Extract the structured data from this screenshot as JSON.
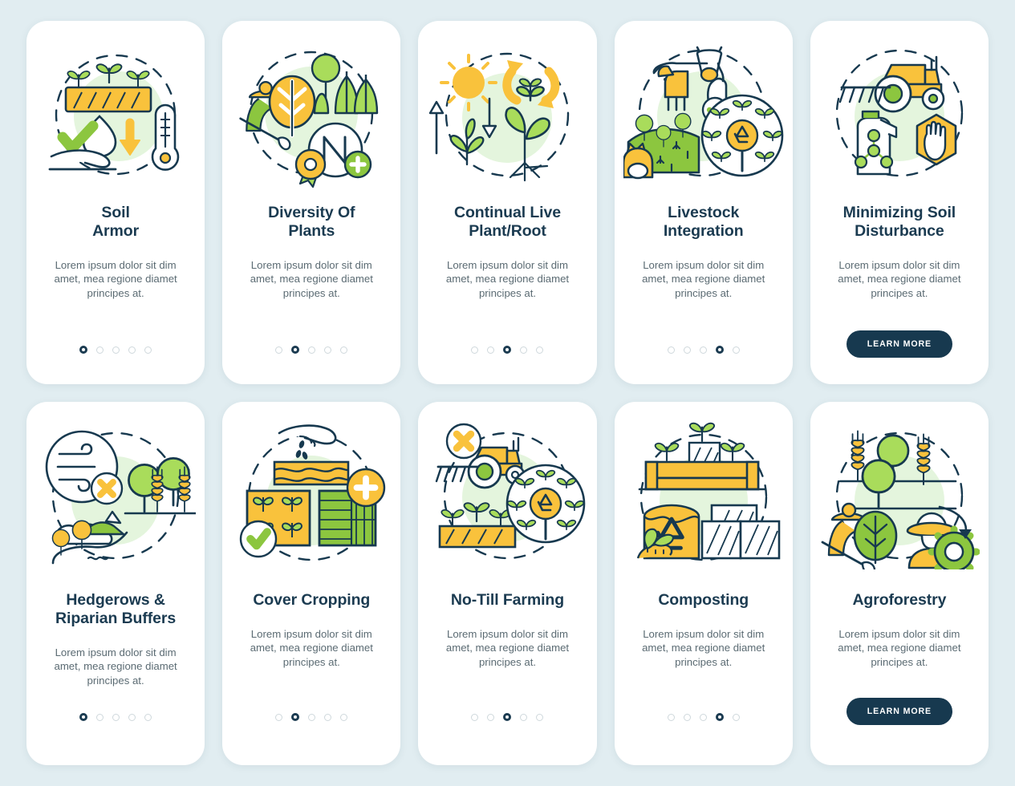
{
  "palette": {
    "background": "#e1edf1",
    "card": "#ffffff",
    "title": "#1b3b51",
    "body_text": "#5b6b73",
    "accent_green": "#8cc63f",
    "accent_green_light": "#a6d94f",
    "accent_yellow": "#f9c23c",
    "accent_dark": "#17394f",
    "halo_green": "#e4f5dd",
    "dot_inactive": "#cfd8dc",
    "dot_active": "#1b3b51",
    "cta_background": "#17394f",
    "cta_text": "#ffffff"
  },
  "common": {
    "description": "Lorem ipsum dolor sit dim amet, mea regione diamet principes at.",
    "cta_label": "LEARN MORE",
    "dot_count": 5
  },
  "cards": [
    {
      "id": "soil-armor",
      "title_lines": [
        "Soil",
        "Armor"
      ],
      "icon": "soil-armor-icon",
      "description": "Lorem ipsum dolor sit dim amet, mea regione diamet principes at.",
      "active_dot": 1,
      "has_cta": false,
      "cta_label": ""
    },
    {
      "id": "diversity-of-plants",
      "title_lines": [
        "Diversity Of",
        "Plants"
      ],
      "icon": "diversity-of-plants-icon",
      "description": "Lorem ipsum dolor sit dim amet, mea regione diamet principes at.",
      "active_dot": 2,
      "has_cta": false,
      "cta_label": ""
    },
    {
      "id": "continual-live-plant-root",
      "title_lines": [
        "Continual Live",
        "Plant/Root"
      ],
      "icon": "continual-live-plant-root-icon",
      "description": "Lorem ipsum dolor sit dim amet, mea regione diamet principes at.",
      "active_dot": 3,
      "has_cta": false,
      "cta_label": ""
    },
    {
      "id": "livestock-integration",
      "title_lines": [
        "Livestock",
        "Integration"
      ],
      "icon": "livestock-integration-icon",
      "description": "Lorem ipsum dolor sit dim amet, mea regione diamet principes at.",
      "active_dot": 4,
      "has_cta": false,
      "cta_label": ""
    },
    {
      "id": "minimizing-soil-disturbance",
      "title_lines": [
        "Minimizing Soil",
        "Disturbance"
      ],
      "icon": "minimizing-soil-disturbance-icon",
      "description": "Lorem ipsum dolor sit dim amet, mea regione diamet principes at.",
      "active_dot": 0,
      "has_cta": true,
      "cta_label": "LEARN MORE"
    },
    {
      "id": "hedgerows-riparian-buffers",
      "title_lines": [
        "Hedgerows &",
        "Riparian Buffers"
      ],
      "icon": "hedgerows-riparian-buffers-icon",
      "description": "Lorem ipsum dolor sit dim amet, mea regione diamet principes at.",
      "active_dot": 1,
      "has_cta": false,
      "cta_label": ""
    },
    {
      "id": "cover-cropping",
      "title_lines": [
        "Cover Cropping"
      ],
      "icon": "cover-cropping-icon",
      "description": "Lorem ipsum dolor sit dim amet, mea regione diamet principes at.",
      "active_dot": 2,
      "has_cta": false,
      "cta_label": ""
    },
    {
      "id": "no-till-farming",
      "title_lines": [
        "No-Till Farming"
      ],
      "icon": "no-till-farming-icon",
      "description": "Lorem ipsum dolor sit dim amet, mea regione diamet principes at.",
      "active_dot": 3,
      "has_cta": false,
      "cta_label": ""
    },
    {
      "id": "composting",
      "title_lines": [
        "Composting"
      ],
      "icon": "composting-icon",
      "description": "Lorem ipsum dolor sit dim amet, mea regione diamet principes at.",
      "active_dot": 4,
      "has_cta": false,
      "cta_label": ""
    },
    {
      "id": "agroforestry",
      "title_lines": [
        "Agroforestry"
      ],
      "icon": "agroforestry-icon",
      "description": "Lorem ipsum dolor sit dim amet, mea regione diamet principes at.",
      "active_dot": 0,
      "has_cta": true,
      "cta_label": "LEARN MORE"
    }
  ]
}
